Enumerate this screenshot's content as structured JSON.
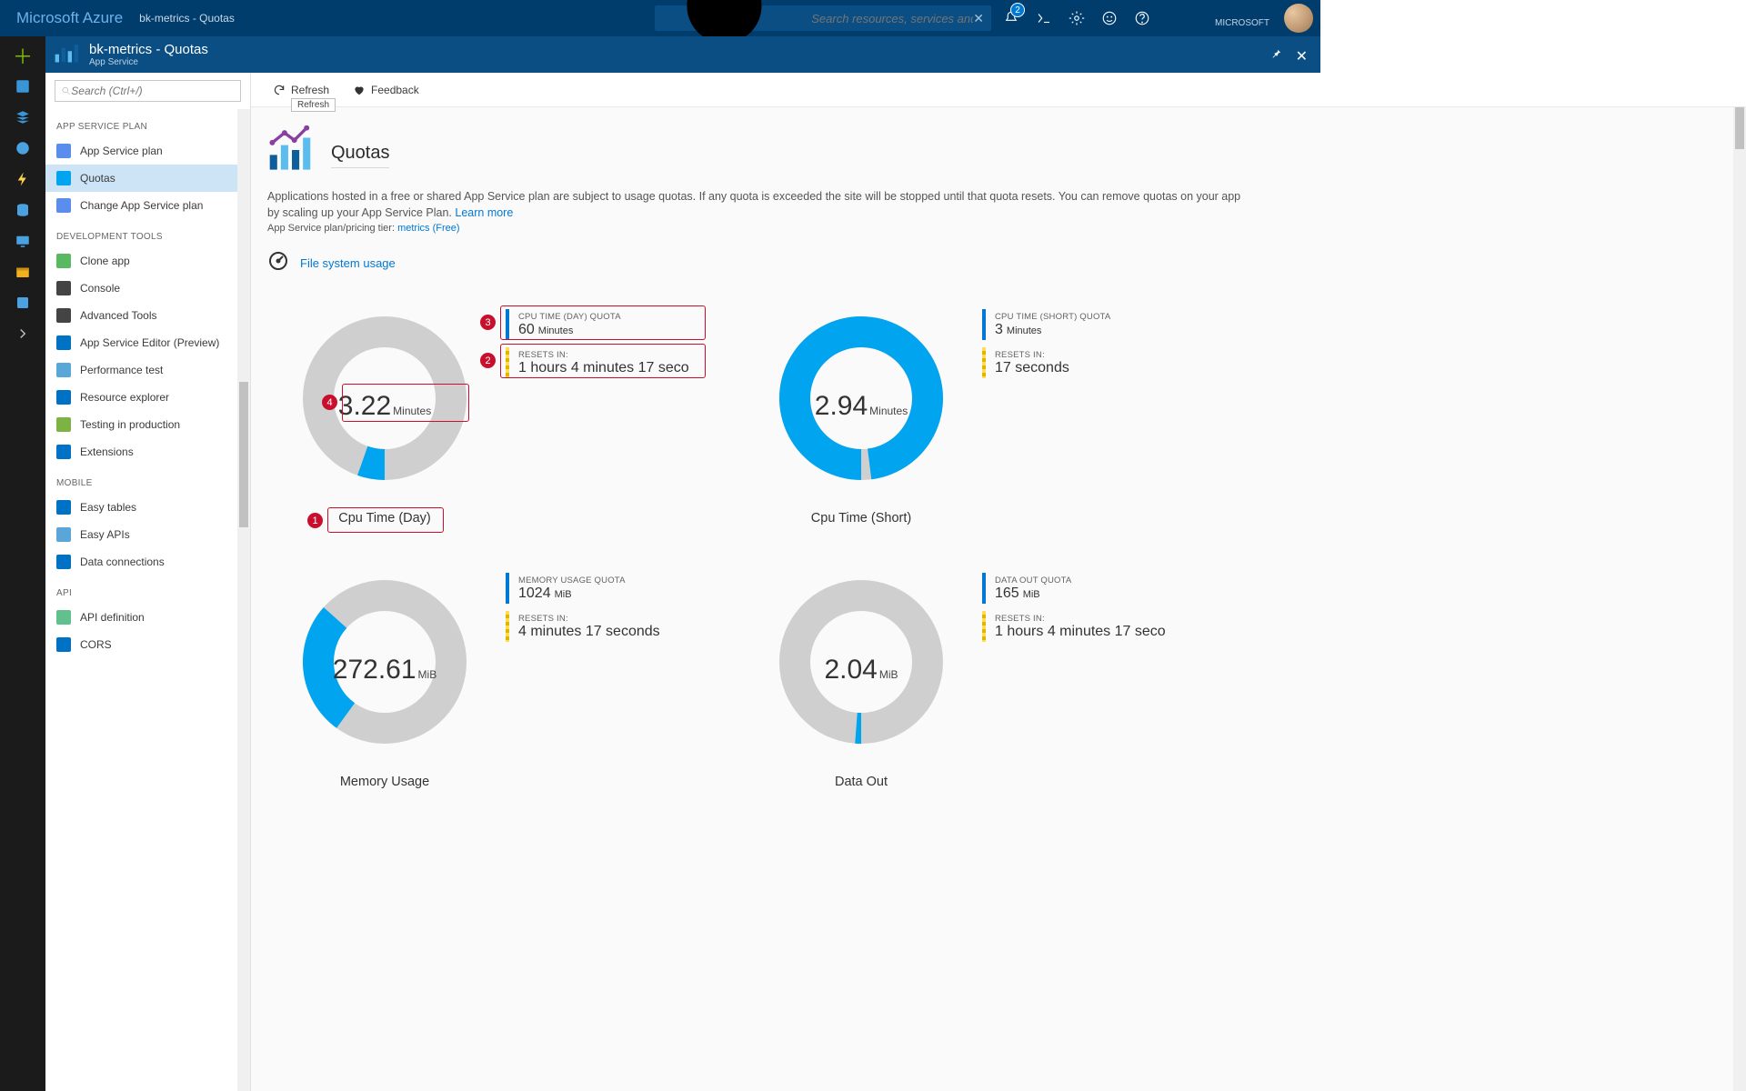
{
  "topbar": {
    "brand": "Microsoft Azure",
    "crumb": "bk-metrics - Quotas",
    "search_placeholder": "Search resources, services and docs",
    "badge_count": "2",
    "account_org": "MICROSOFT"
  },
  "blade": {
    "title": "bk-metrics - Quotas",
    "subtitle": "App Service"
  },
  "resmenu": {
    "search_placeholder": "Search (Ctrl+/)",
    "groups": [
      {
        "label": "APP SERVICE PLAN",
        "items": [
          "App Service plan",
          "Quotas",
          "Change App Service plan"
        ],
        "selected": 1
      },
      {
        "label": "DEVELOPMENT TOOLS",
        "items": [
          "Clone app",
          "Console",
          "Advanced Tools",
          "App Service Editor (Preview)",
          "Performance test",
          "Resource explorer",
          "Testing in production",
          "Extensions"
        ]
      },
      {
        "label": "MOBILE",
        "items": [
          "Easy tables",
          "Easy APIs",
          "Data connections"
        ]
      },
      {
        "label": "API",
        "items": [
          "API definition",
          "CORS"
        ]
      }
    ]
  },
  "cmd": {
    "refresh": "Refresh",
    "feedback": "Feedback",
    "refresh_tip": "Refresh"
  },
  "page": {
    "title": "Quotas",
    "intro": "Applications hosted in a free or shared App Service plan are subject to usage quotas. If any quota is exceeded the site will be stopped until that quota resets. You can remove quotas on your app by scaling up your App Service Plan. ",
    "learn": "Learn more",
    "tier_label": "App Service plan/pricing tier: ",
    "tier_value": "metrics (Free)",
    "fs_link": "File system usage"
  },
  "chart_data": [
    {
      "type": "pie",
      "name": "Cpu Time (Day)",
      "value": 3.22,
      "unit": "Minutes",
      "quota_label": "CPU TIME (DAY) QUOTA",
      "quota_value": "60",
      "quota_unit": "Minutes",
      "resets_label": "RESETS IN:",
      "resets_value": "1 hours 4 minutes 17 seco",
      "pct_used": 5.4
    },
    {
      "type": "pie",
      "name": "Cpu Time (Short)",
      "value": 2.94,
      "unit": "Minutes",
      "quota_label": "CPU TIME (SHORT) QUOTA",
      "quota_value": "3",
      "quota_unit": "Minutes",
      "resets_label": "RESETS IN:",
      "resets_value": "17 seconds",
      "pct_used": 98.0
    },
    {
      "type": "pie",
      "name": "Memory Usage",
      "value": 272.61,
      "unit": "MiB",
      "quota_label": "MEMORY USAGE QUOTA",
      "quota_value": "1024",
      "quota_unit": "MiB",
      "resets_label": "RESETS IN:",
      "resets_value": "4 minutes 17 seconds",
      "pct_used": 26.6
    },
    {
      "type": "pie",
      "name": "Data Out",
      "value": 2.04,
      "unit": "MiB",
      "quota_label": "DATA OUT QUOTA",
      "quota_value": "165",
      "quota_unit": "MiB",
      "resets_label": "RESETS IN:",
      "resets_value": "1 hours 4 minutes 17 seco",
      "pct_used": 1.2
    }
  ],
  "colors": {
    "used": "#00a4ef",
    "remaining": "#cfcfcf",
    "accent": "#0078d4",
    "callout": "#c8102e"
  },
  "annotations": {
    "n1": "1",
    "n2": "2",
    "n3": "3",
    "n4": "4"
  }
}
